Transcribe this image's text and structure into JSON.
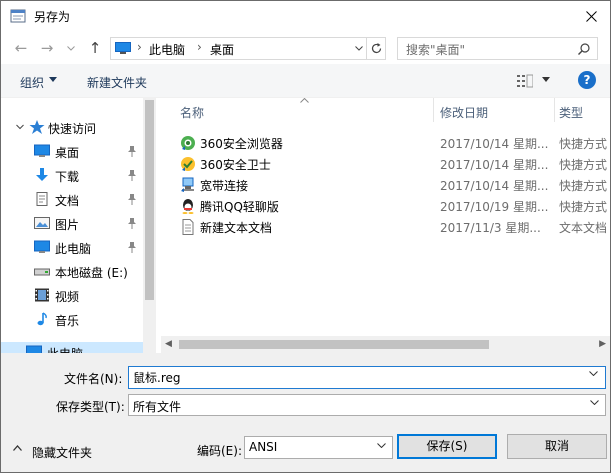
{
  "window": {
    "title": "另存为",
    "close_label": "✕"
  },
  "nav": {
    "back": "←",
    "forward": "→",
    "recent": "⌄",
    "up": "↑",
    "breadcrumb": [
      "此电脑",
      "桌面"
    ],
    "search_placeholder": "搜索\"桌面\""
  },
  "toolbar": {
    "organize": "组织",
    "new_folder": "新建文件夹",
    "help": "?"
  },
  "sidebar": {
    "items": [
      {
        "label": "快速访问",
        "icon": "star-icon",
        "pinned": false
      },
      {
        "label": "桌面",
        "icon": "desktop-icon",
        "pinned": true
      },
      {
        "label": "下载",
        "icon": "download-icon",
        "pinned": true
      },
      {
        "label": "文档",
        "icon": "document-icon",
        "pinned": true
      },
      {
        "label": "图片",
        "icon": "pictures-icon",
        "pinned": true
      },
      {
        "label": "此电脑",
        "icon": "computer-icon",
        "pinned": true
      },
      {
        "label": "本地磁盘 (E:)",
        "icon": "drive-icon",
        "pinned": false
      },
      {
        "label": "视频",
        "icon": "video-icon",
        "pinned": false
      },
      {
        "label": "音乐",
        "icon": "music-icon",
        "pinned": false
      },
      {
        "label": "此电脑",
        "icon": "computer-icon",
        "pinned": false
      }
    ]
  },
  "filelist": {
    "columns": {
      "name": "名称",
      "date": "修改日期",
      "type": "类型"
    },
    "files": [
      {
        "name": "360安全浏览器",
        "date": "2017/10/14 星期...",
        "type": "快捷方式",
        "icon": "browser-360-icon"
      },
      {
        "name": "360安全卫士",
        "date": "2017/10/14 星期...",
        "type": "快捷方式",
        "icon": "guard-360-icon"
      },
      {
        "name": "宽带连接",
        "date": "2017/10/14 星期...",
        "type": "快捷方式",
        "icon": "broadband-icon"
      },
      {
        "name": "腾讯QQ轻聊版",
        "date": "2017/10/19 星期...",
        "type": "快捷方式",
        "icon": "qq-icon"
      },
      {
        "name": "新建文本文档",
        "date": "2017/11/3 星期...",
        "type": "文本文档",
        "icon": "text-file-icon"
      }
    ]
  },
  "form": {
    "filename_label": "文件名(N):",
    "filename_value": "鼠标.reg",
    "filetype_label": "保存类型(T):",
    "filetype_value": "所有文件",
    "hide_folders": "隐藏文件夹",
    "encoding_label": "编码(E):",
    "encoding_value": "ANSI",
    "save": "保存(S)",
    "cancel": "取消"
  },
  "colors": {
    "accent": "#0078d7",
    "selection": "#cce8ff",
    "help": "#1a6fc9"
  }
}
